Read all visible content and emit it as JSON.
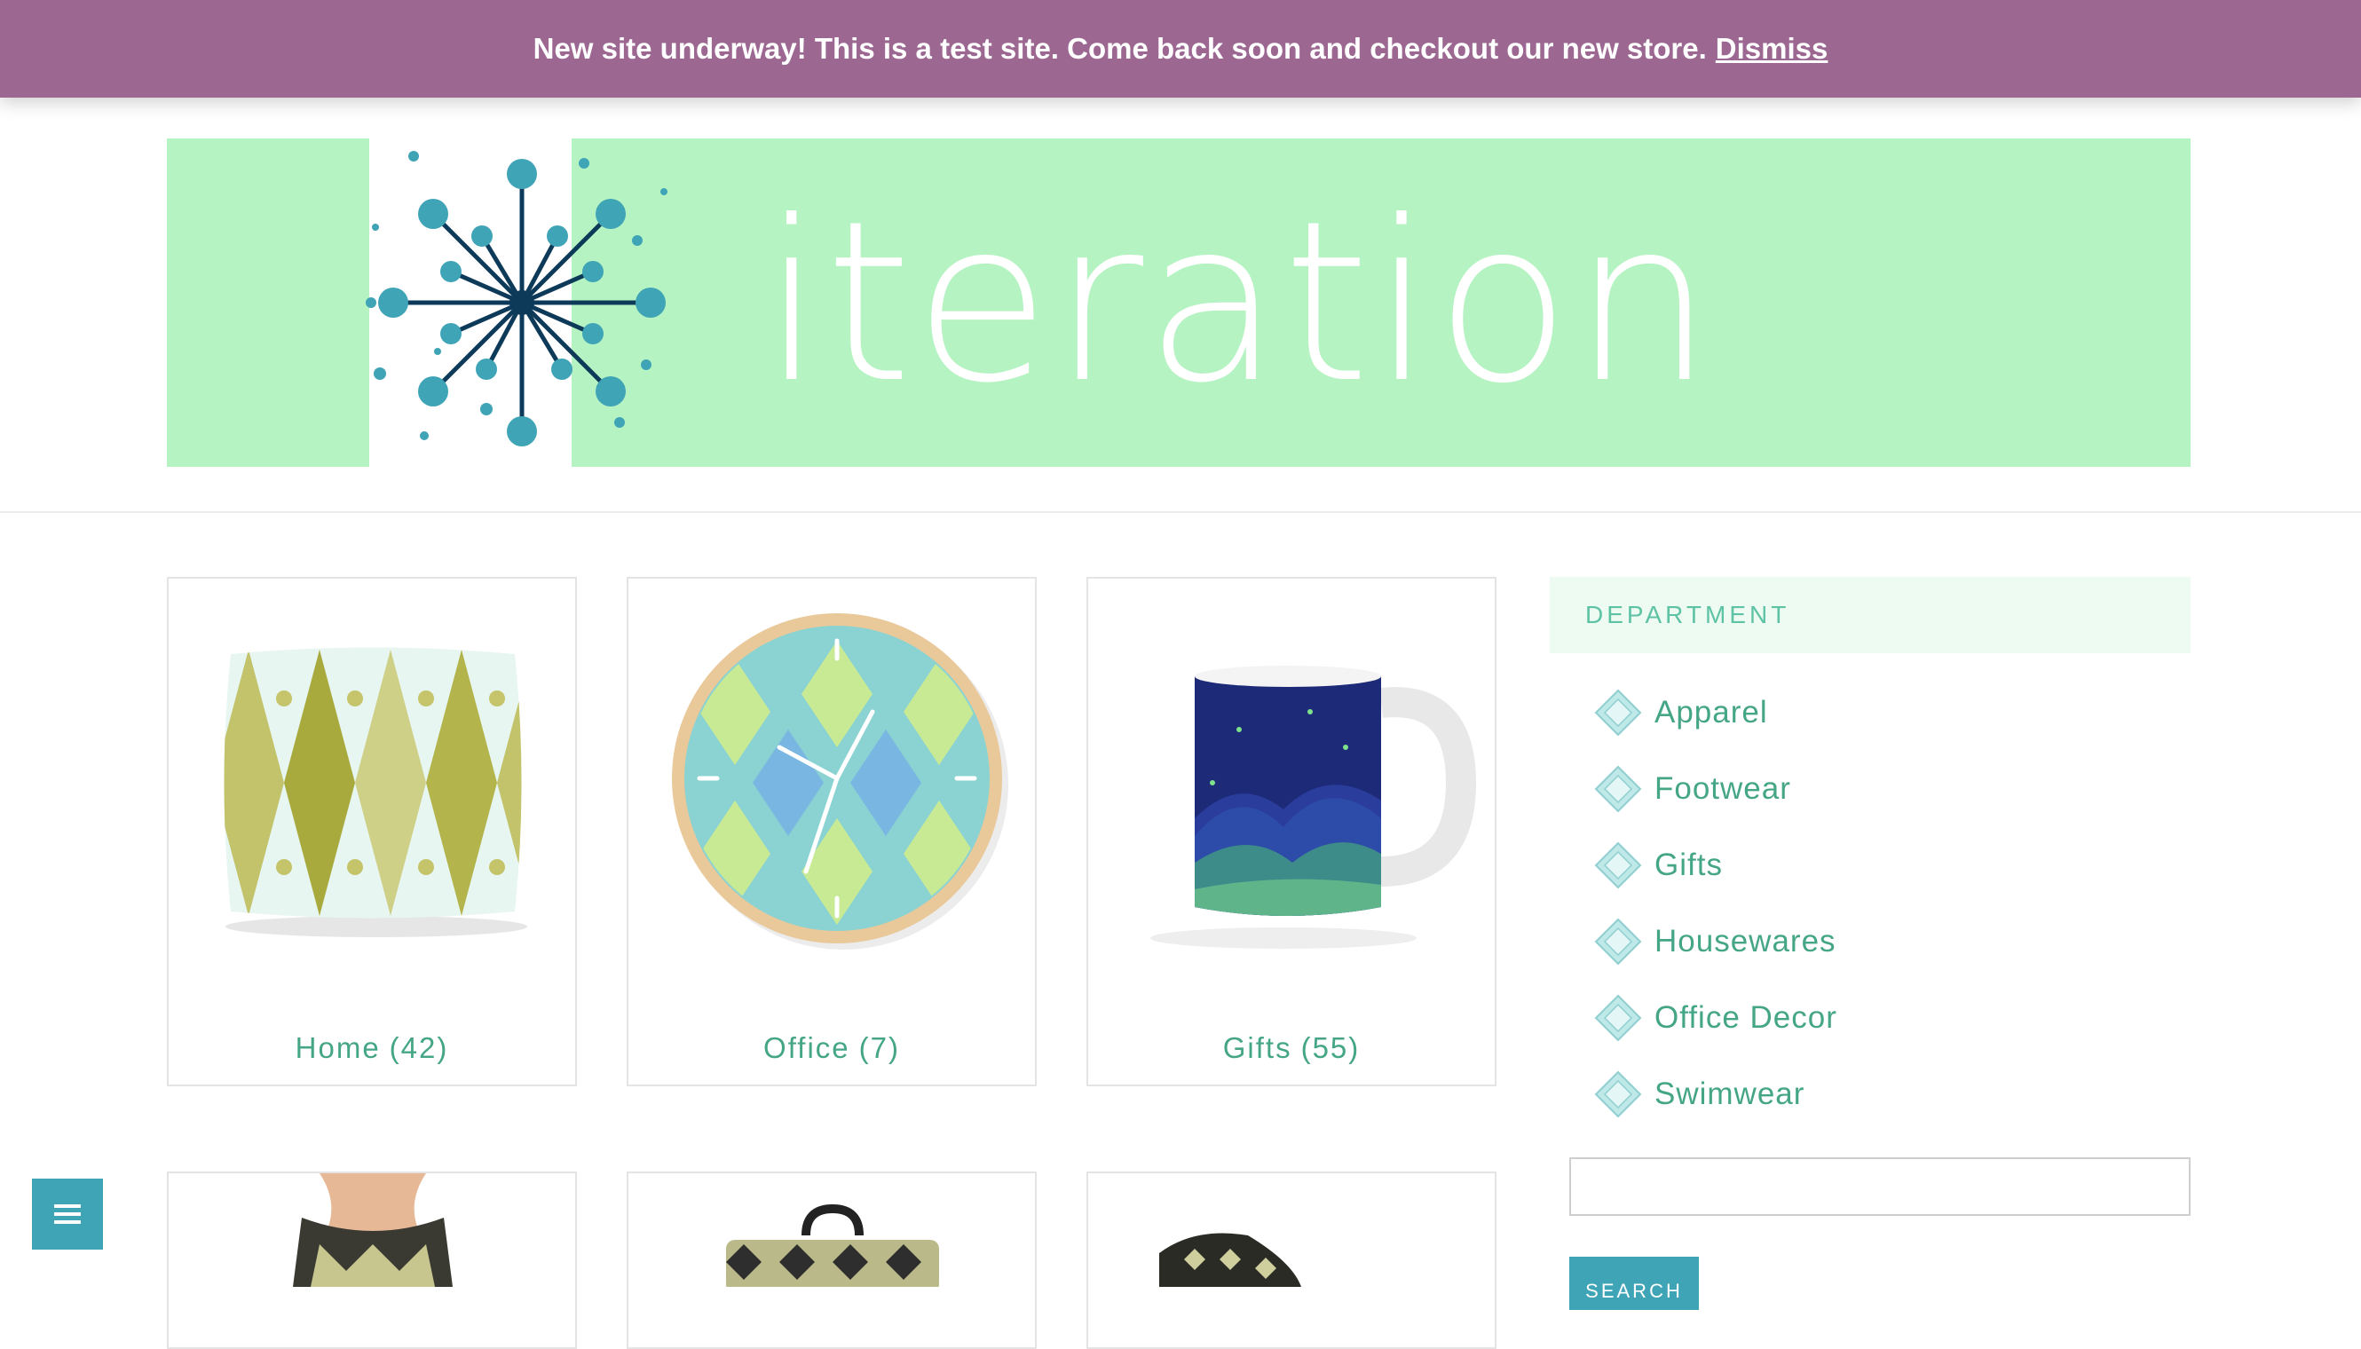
{
  "notice": {
    "message": "New site underway! This is a test site. Come back soon and checkout our new store.",
    "dismiss_label": "Dismiss",
    "background": "#9c6892"
  },
  "header": {
    "logo_text": "iteration",
    "banner_color": "#b6f3c3"
  },
  "categories": [
    {
      "name": "Home",
      "count": "(42)",
      "image": "pillow-image"
    },
    {
      "name": "Office",
      "count": "(7)",
      "image": "clock-image"
    },
    {
      "name": "Gifts",
      "count": "(55)",
      "image": "mug-image"
    }
  ],
  "sidebar": {
    "heading": "DEPARTMENT",
    "items": [
      {
        "label": "Apparel"
      },
      {
        "label": "Footwear"
      },
      {
        "label": "Gifts"
      },
      {
        "label": "Housewares"
      },
      {
        "label": "Office Decor"
      },
      {
        "label": "Swimwear"
      }
    ],
    "search": {
      "placeholder": "",
      "button_label": "SEARCH"
    }
  },
  "colors": {
    "accent": "#45a687",
    "button": "#3fa4b6",
    "sidebar_head_bg": "#eefbf2"
  }
}
